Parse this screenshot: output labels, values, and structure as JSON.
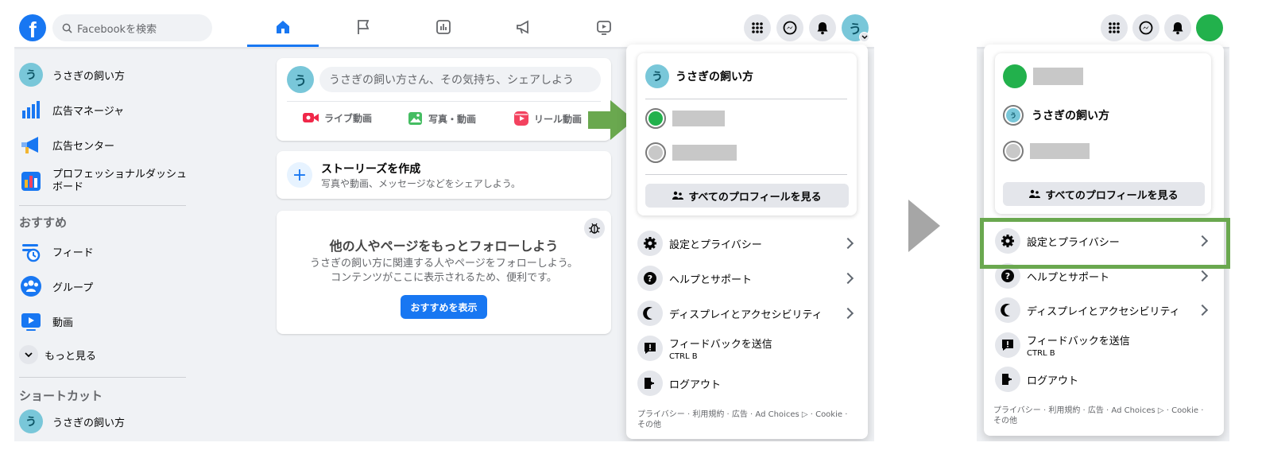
{
  "search": {
    "placeholder": "Facebookを検索"
  },
  "sidebar": {
    "items": [
      {
        "label": "うさぎの飼い方"
      },
      {
        "label": "広告マネージャ"
      },
      {
        "label": "広告センター"
      },
      {
        "label": "プロフェッショナルダッシュボード"
      }
    ],
    "recommend_heading": "おすすめ",
    "recommend": [
      {
        "label": "フィード"
      },
      {
        "label": "グループ"
      },
      {
        "label": "動画"
      }
    ],
    "more": "もっと見る",
    "shortcuts_heading": "ショートカット",
    "shortcuts": [
      {
        "label": "うさぎの飼い方"
      }
    ]
  },
  "avatar_char": "う",
  "composer": {
    "placeholder": "うさぎの飼い方さん、その気持ち、シェアしよう",
    "actions": [
      {
        "label": "ライブ動画"
      },
      {
        "label": "写真・動画"
      },
      {
        "label": "リール動画"
      }
    ]
  },
  "story": {
    "title": "ストーリーズを作成",
    "subtitle": "写真や動画、メッセージなどをシェアしよう。",
    "plus": "+"
  },
  "follow": {
    "title": "他の人やページをもっとフォローしよう",
    "line1": "うさぎの飼い方に関連する人やページをフォローしよう。",
    "line2": "コンテンツがここに表示されるため、便利です。",
    "button": "おすすめを表示"
  },
  "menu": {
    "profile_name": "うさぎの飼い方",
    "all_profiles": "すべてのプロフィールを見る",
    "items": [
      {
        "label": "設定とプライバシー"
      },
      {
        "label": "ヘルプとサポート"
      },
      {
        "label": "ディスプレイとアクセシビリティ"
      },
      {
        "label": "フィードバックを送信",
        "sub": "CTRL B"
      },
      {
        "label": "ログアウト"
      }
    ],
    "footer_line1": "プライバシー · 利用規約 · 広告 · Ad Choices ▷ · Cookie ·",
    "footer_line2": "その他"
  },
  "colors": {
    "brand": "#1877f2",
    "green_arrow": "#6aa84f",
    "highlight_box": "#6aa84f",
    "green_profile": "#22b14c",
    "avatar_bg": "#79c7d9"
  }
}
